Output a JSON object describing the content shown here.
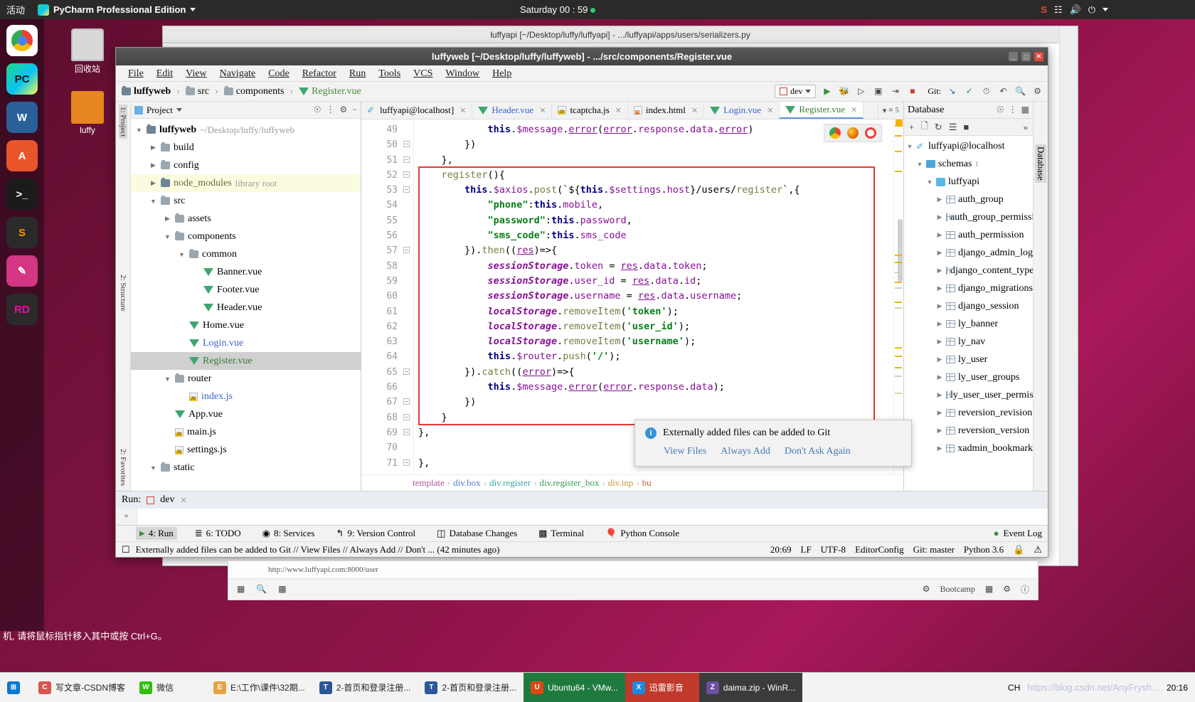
{
  "ubuntu": {
    "activities": "活动",
    "app_name": "PyCharm Professional Edition",
    "clock": "Saturday 00 : 59",
    "launcher_items": [
      {
        "name": "chrome",
        "label": "C"
      },
      {
        "name": "pycharm",
        "label": "PC"
      },
      {
        "name": "libreoffice-writer",
        "label": "W"
      },
      {
        "name": "software",
        "label": "A"
      },
      {
        "name": "terminal",
        "label": ">_"
      },
      {
        "name": "sublime",
        "label": "S"
      },
      {
        "name": "pen",
        "label": "/"
      },
      {
        "name": "rider",
        "label": "RD"
      }
    ],
    "desktop_icons": [
      {
        "name": "trash",
        "label": "回收站"
      },
      {
        "name": "luffy-folder",
        "label": "luffy"
      }
    ]
  },
  "window": {
    "title": "luffyweb [~/Desktop/luffy/luffyweb] - .../src/components/Register.vue",
    "bg_title": "luffyapi [~/Desktop/luffy/luffyapi] - .../luffyapi/apps/users/serializers.py"
  },
  "menubar": [
    "File",
    "Edit",
    "View",
    "Navigate",
    "Code",
    "Refactor",
    "Run",
    "Tools",
    "VCS",
    "Window",
    "Help"
  ],
  "navbar": {
    "crumbs": [
      {
        "label": "luffyweb",
        "icon": "folder-icon",
        "bold": true
      },
      {
        "label": "src",
        "icon": "folder-icon",
        "bold": false
      },
      {
        "label": "components",
        "icon": "folder-icon",
        "bold": false
      },
      {
        "label": "Register.vue",
        "icon": "vue-icon",
        "bold": false
      }
    ],
    "run_config": "dev",
    "git_label": "Git:"
  },
  "project": {
    "panel_title": "Project",
    "tree": [
      {
        "depth": 0,
        "label": "luffyweb",
        "sub": "~/Desktop/luffy/luffyweb",
        "icon": "folder-icon",
        "arrow": "▼",
        "bold": true,
        "state": ""
      },
      {
        "depth": 1,
        "label": "build",
        "sub": "",
        "icon": "folder-icon",
        "arrow": "▶",
        "bold": false,
        "state": ""
      },
      {
        "depth": 1,
        "label": "config",
        "sub": "",
        "icon": "folder-icon",
        "arrow": "▶",
        "bold": false,
        "state": ""
      },
      {
        "depth": 1,
        "label": "node_modules",
        "sub": "library root",
        "icon": "folder-icon",
        "arrow": "▶",
        "bold": false,
        "state": "hl"
      },
      {
        "depth": 1,
        "label": "src",
        "sub": "",
        "icon": "folder-icon",
        "arrow": "▼",
        "bold": false,
        "state": ""
      },
      {
        "depth": 2,
        "label": "assets",
        "sub": "",
        "icon": "folder-icon",
        "arrow": "▶",
        "bold": false,
        "state": ""
      },
      {
        "depth": 2,
        "label": "components",
        "sub": "",
        "icon": "folder-icon",
        "arrow": "▼",
        "bold": false,
        "state": ""
      },
      {
        "depth": 3,
        "label": "common",
        "sub": "",
        "icon": "folder-icon",
        "arrow": "▼",
        "bold": false,
        "state": ""
      },
      {
        "depth": 4,
        "label": "Banner.vue",
        "sub": "",
        "icon": "vue-icon",
        "arrow": "",
        "bold": false,
        "state": ""
      },
      {
        "depth": 4,
        "label": "Footer.vue",
        "sub": "",
        "icon": "vue-icon",
        "arrow": "",
        "bold": false,
        "state": ""
      },
      {
        "depth": 4,
        "label": "Header.vue",
        "sub": "",
        "icon": "vue-icon",
        "arrow": "",
        "bold": false,
        "state": ""
      },
      {
        "depth": 3,
        "label": "Home.vue",
        "sub": "",
        "icon": "vue-icon",
        "arrow": "",
        "bold": false,
        "state": ""
      },
      {
        "depth": 3,
        "label": "Login.vue",
        "sub": "",
        "icon": "vue-icon",
        "arrow": "",
        "bold": false,
        "state": "blue"
      },
      {
        "depth": 3,
        "label": "Register.vue",
        "sub": "",
        "icon": "vue-icon",
        "arrow": "",
        "bold": false,
        "state": "sel"
      },
      {
        "depth": 2,
        "label": "router",
        "sub": "",
        "icon": "folder-icon",
        "arrow": "▼",
        "bold": false,
        "state": ""
      },
      {
        "depth": 3,
        "label": "index.js",
        "sub": "",
        "icon": "js-icon",
        "arrow": "",
        "bold": false,
        "state": "blue"
      },
      {
        "depth": 2,
        "label": "App.vue",
        "sub": "",
        "icon": "vue-icon",
        "arrow": "",
        "bold": false,
        "state": ""
      },
      {
        "depth": 2,
        "label": "main.js",
        "sub": "",
        "icon": "js-icon",
        "arrow": "",
        "bold": false,
        "state": ""
      },
      {
        "depth": 2,
        "label": "settings.js",
        "sub": "",
        "icon": "js-icon",
        "arrow": "",
        "bold": false,
        "state": ""
      },
      {
        "depth": 1,
        "label": "static",
        "sub": "",
        "icon": "folder-icon",
        "arrow": "▼",
        "bold": false,
        "state": ""
      }
    ]
  },
  "left_strips": {
    "top": "1: Project",
    "mid": "2: Structure",
    "bottom": "2: Favorites"
  },
  "editor": {
    "tabs": [
      {
        "label": "luffyapi@localhost]",
        "icon": "db-icon",
        "active": false
      },
      {
        "label": "Header.vue",
        "icon": "vue-icon",
        "active": false
      },
      {
        "label": "tcaptcha.js",
        "icon": "js-icon",
        "active": false
      },
      {
        "label": "index.html",
        "icon": "html-icon",
        "active": false
      },
      {
        "label": "Login.vue",
        "icon": "vue-icon",
        "active": false
      },
      {
        "label": "Register.vue",
        "icon": "vue-icon",
        "active": true
      }
    ],
    "tabs_badge": "5",
    "first_line_no": 49,
    "lines": [
      {
        "n": 49,
        "fold": "",
        "code": "            this.$message.error(error.response.data.error)"
      },
      {
        "n": 50,
        "fold": "-",
        "code": "        })"
      },
      {
        "n": 51,
        "fold": "-",
        "code": "    },"
      },
      {
        "n": 52,
        "fold": "-",
        "code": "    register(){"
      },
      {
        "n": 53,
        "fold": "-",
        "code": "        this.$axios.post(`${this.$settings.host}/users/register`,{"
      },
      {
        "n": 54,
        "fold": "",
        "code": "            \"phone\":this.mobile,"
      },
      {
        "n": 55,
        "fold": "",
        "code": "            \"password\":this.password,"
      },
      {
        "n": 56,
        "fold": "",
        "code": "            \"sms_code\":this.sms_code"
      },
      {
        "n": 57,
        "fold": "-",
        "code": "        }).then((res)=>{"
      },
      {
        "n": 58,
        "fold": "",
        "code": "            sessionStorage.token = res.data.token;"
      },
      {
        "n": 59,
        "fold": "",
        "code": "            sessionStorage.user_id = res.data.id;"
      },
      {
        "n": 60,
        "fold": "",
        "code": "            sessionStorage.username = res.data.username;"
      },
      {
        "n": 61,
        "fold": "",
        "code": "            localStorage.removeItem('token');"
      },
      {
        "n": 62,
        "fold": "",
        "code": "            localStorage.removeItem('user_id');"
      },
      {
        "n": 63,
        "fold": "",
        "code": "            localStorage.removeItem('username');"
      },
      {
        "n": 64,
        "fold": "",
        "code": "            this.$router.push('/');"
      },
      {
        "n": 65,
        "fold": "-",
        "code": "        }).catch((error)=>{"
      },
      {
        "n": 66,
        "fold": "",
        "code": "            this.$message.error(error.response.data);"
      },
      {
        "n": 67,
        "fold": "-",
        "code": "        })"
      },
      {
        "n": 68,
        "fold": "-",
        "code": "    }"
      },
      {
        "n": 69,
        "fold": "-",
        "code": "},"
      },
      {
        "n": 70,
        "fold": "",
        "code": ""
      },
      {
        "n": 71,
        "fold": "-",
        "code": "},"
      }
    ],
    "breadcrumbs": [
      "template",
      "div.box",
      "div.register",
      "div.register_box",
      "div.inp",
      "bu"
    ],
    "browsers": [
      "chrome",
      "firefox",
      "opera"
    ]
  },
  "database": {
    "panel_title": "Database",
    "tree": [
      {
        "depth": 0,
        "label": "luffyapi@localhost",
        "icon": "db-icon",
        "arrow": "▼"
      },
      {
        "depth": 1,
        "label": "schemas",
        "icon": "schema-icon",
        "arrow": "▼",
        "badge": "1"
      },
      {
        "depth": 2,
        "label": "luffyapi",
        "icon": "luffy-icon",
        "arrow": "▼"
      },
      {
        "depth": 3,
        "label": "auth_group",
        "icon": "table-icon",
        "arrow": "▶"
      },
      {
        "depth": 3,
        "label": "auth_group_permissions",
        "icon": "table-icon",
        "arrow": "▶"
      },
      {
        "depth": 3,
        "label": "auth_permission",
        "icon": "table-icon",
        "arrow": "▶"
      },
      {
        "depth": 3,
        "label": "django_admin_log",
        "icon": "table-icon",
        "arrow": "▶"
      },
      {
        "depth": 3,
        "label": "django_content_type",
        "icon": "table-icon",
        "arrow": "▶"
      },
      {
        "depth": 3,
        "label": "django_migrations",
        "icon": "table-icon",
        "arrow": "▶"
      },
      {
        "depth": 3,
        "label": "django_session",
        "icon": "table-icon",
        "arrow": "▶"
      },
      {
        "depth": 3,
        "label": "ly_banner",
        "icon": "table-icon",
        "arrow": "▶"
      },
      {
        "depth": 3,
        "label": "ly_nav",
        "icon": "table-icon",
        "arrow": "▶"
      },
      {
        "depth": 3,
        "label": "ly_user",
        "icon": "table-icon",
        "arrow": "▶"
      },
      {
        "depth": 3,
        "label": "ly_user_groups",
        "icon": "table-icon",
        "arrow": "▶"
      },
      {
        "depth": 3,
        "label": "ly_user_user_permissions",
        "icon": "table-icon",
        "arrow": "▶"
      },
      {
        "depth": 3,
        "label": "reversion_revision",
        "icon": "table-icon",
        "arrow": "▶"
      },
      {
        "depth": 3,
        "label": "reversion_version",
        "icon": "table-icon",
        "arrow": "▶"
      },
      {
        "depth": 3,
        "label": "xadmin_bookmark",
        "icon": "table-icon",
        "arrow": "▶"
      }
    ]
  },
  "run_window": {
    "label": "Run:",
    "config": "dev",
    "console_prompt": "»"
  },
  "toolwindow_bar": [
    {
      "label": "4: Run",
      "icon": "play-icon",
      "selected": true
    },
    {
      "label": "6: TODO",
      "icon": "list-icon",
      "selected": false
    },
    {
      "label": "8: Services",
      "icon": "services-icon",
      "selected": false
    },
    {
      "label": "9: Version Control",
      "icon": "branch-icon",
      "selected": false
    },
    {
      "label": "Database Changes",
      "icon": "db-changes-icon",
      "selected": false
    },
    {
      "label": "Terminal",
      "icon": "terminal-icon",
      "selected": false
    },
    {
      "label": "Python Console",
      "icon": "python-icon",
      "selected": false
    }
  ],
  "toolwindow_right": {
    "label": "Event Log",
    "icon": "event-log-icon"
  },
  "statusbar": {
    "message": "Externally added files can be added to Git // View Files // Always Add // Don't ... (42 minutes ago)",
    "caret": "20:69",
    "line_sep": "LF",
    "encoding": "UTF-8",
    "editorconfig": "EditorConfig",
    "git_branch": "Git: master",
    "interpreter": "Python 3.6"
  },
  "balloon": {
    "title": "Externally added files can be added to Git",
    "links": [
      "View Files",
      "Always Add",
      "Don't Ask Again"
    ]
  },
  "bottom_window": {
    "url": "http://www.luffyapi.com:8000/user",
    "bootcamp": "Bootcamp"
  },
  "cn_hint": "机, 请将鼠标指针移入其中或按 Ctrl+G。",
  "taskbar": {
    "items": [
      {
        "label": "写文章-CSDN博客",
        "icon_label": "C",
        "icon_color": "#d9534f",
        "state": ""
      },
      {
        "label": "微信",
        "icon_label": "W",
        "icon_color": "#2dc100",
        "state": ""
      },
      {
        "label": "E:\\工作\\课件\\32期...",
        "icon_label": "E",
        "icon_color": "#e8a33d",
        "state": ""
      },
      {
        "label": "2-首页和登录注册...",
        "icon_label": "T",
        "icon_color": "#2b579a",
        "state": ""
      },
      {
        "label": "2-首页和登录注册...",
        "icon_label": "T",
        "icon_color": "#2b579a",
        "state": ""
      },
      {
        "label": "Ubuntu64 - VMw...",
        "icon_label": "U",
        "icon_color": "#dd4814",
        "state": "active-green"
      },
      {
        "label": "迅雷影音",
        "icon_label": "X",
        "icon_color": "#1e88e5",
        "state": "active-red"
      },
      {
        "label": "daima.zip - WinR...",
        "icon_label": "Z",
        "icon_color": "#6b4fa0",
        "state": "active-dark"
      }
    ],
    "tray_text": "CH",
    "watermark": "https://blog.csdn.net/AnyFrysh...",
    "clock": "20:16"
  }
}
